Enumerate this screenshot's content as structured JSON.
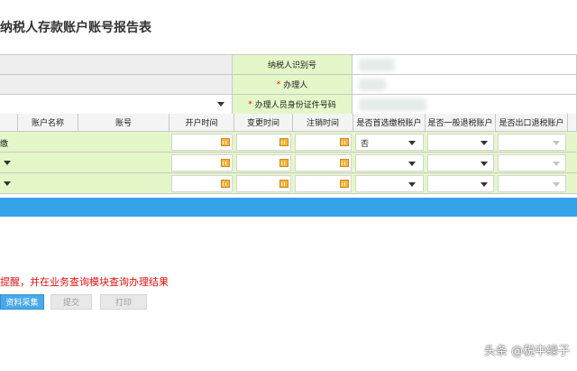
{
  "page": {
    "title": "纳税人存款账户账号报告表"
  },
  "info": {
    "taxpayer_id_label": "纳税人识别号",
    "handler_label": "办理人",
    "handler_id_label": "办理人员身份证件号码",
    "required_mark": "*"
  },
  "table": {
    "headers": [
      "账户名称",
      "账号",
      "开户时间",
      "变更时间",
      "注销时间",
      "是否首选缴税账户",
      "是否一般退税账户",
      "是否出口退税账户"
    ],
    "rows": [
      {
        "first_col_fragment": "缴",
        "is_preferred": "否"
      },
      {
        "first_col_fragment": "",
        "is_preferred": ""
      },
      {
        "first_col_fragment": "",
        "is_preferred": ""
      }
    ]
  },
  "notice": {
    "text": "提醒，并在业务查询模块查询办理结果"
  },
  "buttons": {
    "collect": "资料采集",
    "submit": "提交",
    "print": "打印"
  },
  "watermark": {
    "text": "头条 @税中绿子"
  },
  "colors": {
    "row_green": "#e4f7c8",
    "bar_blue": "#35a3ea",
    "notice_red": "#e01010"
  }
}
